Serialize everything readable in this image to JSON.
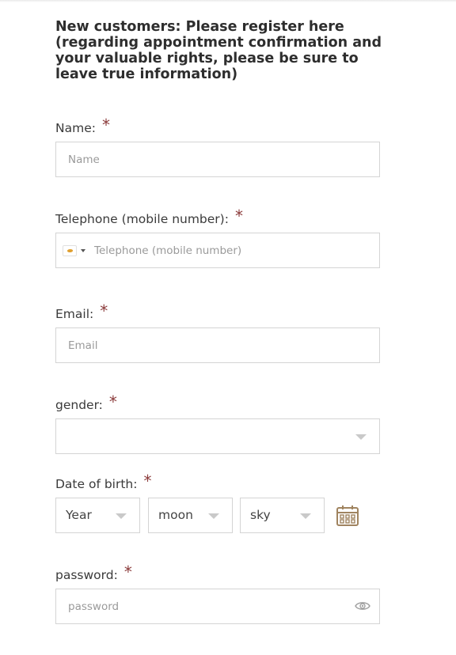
{
  "form": {
    "title": "New customers: Please register here (regarding appointment confirmation and your valuable rights, please be sure to leave true information)",
    "required_mark": "*",
    "name": {
      "label": "Name:",
      "placeholder": "Name",
      "value": ""
    },
    "phone": {
      "label": "Telephone (mobile number):",
      "placeholder": "Telephone (mobile number)",
      "value": "",
      "flag_icon": "flag-icon"
    },
    "email": {
      "label": "Email:",
      "placeholder": "Email",
      "value": ""
    },
    "gender": {
      "label": "gender:",
      "selected": ""
    },
    "dob": {
      "label": "Date of birth:",
      "year": "Year",
      "month": "moon",
      "day": "sky",
      "calendar_icon": "calendar-icon"
    },
    "password": {
      "label": "password:",
      "placeholder": "password",
      "value": "",
      "toggle_icon": "eye-icon"
    }
  },
  "colors": {
    "required": "#8b3a3a",
    "border": "#d4d4d4",
    "calendar_icon": "#a08460",
    "caret": "#c9c9c9"
  }
}
